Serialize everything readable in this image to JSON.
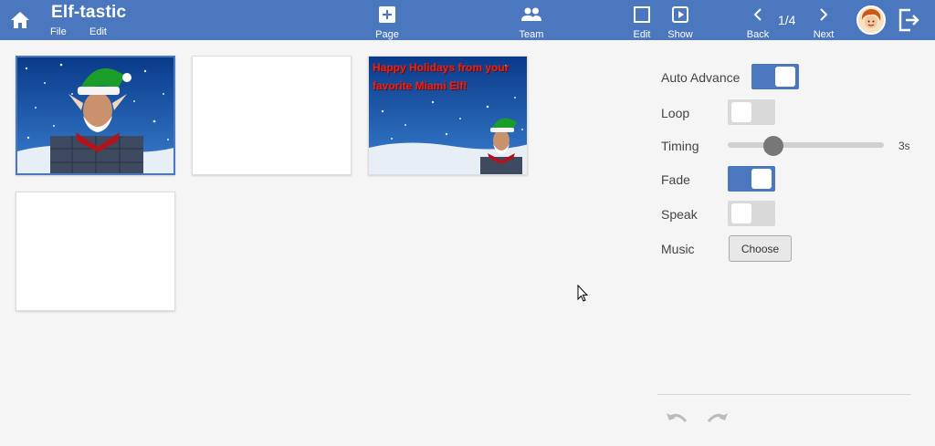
{
  "app": {
    "title": "Elf-tastic",
    "menus": {
      "file": "File",
      "edit": "Edit"
    }
  },
  "toolbar": {
    "page": "Page",
    "team": "Team",
    "edit": "Edit",
    "show": "Show",
    "back": "Back",
    "next": "Next",
    "page_counter": "1/4"
  },
  "slides": {
    "slide3_text": "Happy Holidays from your favorite Miami Elf!"
  },
  "settings": {
    "auto_advance": {
      "label": "Auto Advance",
      "on": true
    },
    "loop": {
      "label": "Loop",
      "on": false
    },
    "timing": {
      "label": "Timing",
      "value": "3s"
    },
    "fade": {
      "label": "Fade",
      "on": true
    },
    "speak": {
      "label": "Speak",
      "on": false
    },
    "music": {
      "label": "Music",
      "button": "Choose"
    }
  },
  "colors": {
    "toolbar": "#4a77be",
    "toggle_on": "#4a77be",
    "toggle_off": "#d9d9d9",
    "slide_text": "#e0261b"
  }
}
